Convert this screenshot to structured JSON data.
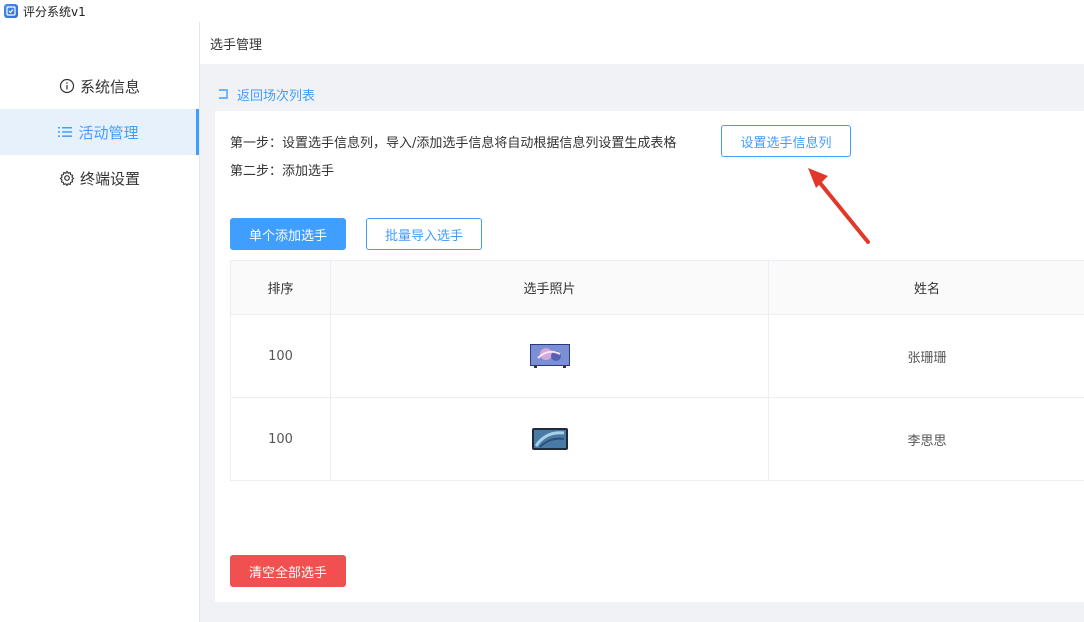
{
  "app": {
    "title": "评分系统v1"
  },
  "sidebar": {
    "items": [
      {
        "label": "系统信息",
        "icon": "info-circle-icon",
        "active": false
      },
      {
        "label": "活动管理",
        "icon": "list-icon",
        "active": true
      },
      {
        "label": "终端设置",
        "icon": "gear-icon",
        "active": false
      }
    ]
  },
  "header": {
    "title": "选手管理"
  },
  "back": {
    "label": "返回场次列表"
  },
  "steps": {
    "step1": "第一步：设置选手信息列，导入/添加选手信息将自动根据信息列设置生成表格",
    "step1_button": "设置选手信息列",
    "step2": "第二步：添加选手"
  },
  "actions": {
    "add_single": "单个添加选手",
    "batch_import": "批量导入选手",
    "clear_all": "清空全部选手"
  },
  "table": {
    "headers": {
      "order": "排序",
      "photo": "选手照片",
      "name": "姓名"
    },
    "rows": [
      {
        "order": "100",
        "name": "张珊珊",
        "photo": "tv-thumbnail-icon"
      },
      {
        "order": "100",
        "name": "李思思",
        "photo": "tablet-thumbnail-icon"
      }
    ]
  },
  "colors": {
    "accent": "#409eff",
    "danger": "#f05050",
    "annotation": "#e0392b"
  }
}
